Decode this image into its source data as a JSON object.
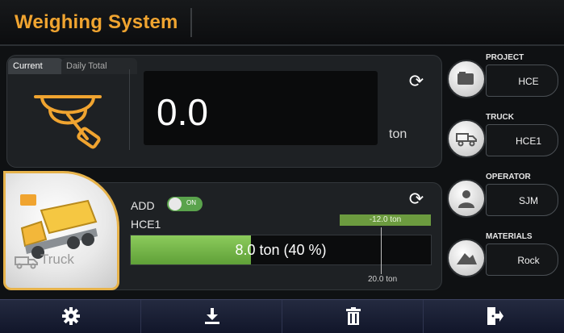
{
  "header": {
    "title": "Weighing System"
  },
  "tabs": {
    "current": "Current",
    "daily_total": "Daily Total"
  },
  "display": {
    "value": "0.0",
    "unit": "ton"
  },
  "truck_card": {
    "label": "Truck"
  },
  "add_toggle": {
    "label": "ADD",
    "state_text": "ON",
    "on": true
  },
  "load": {
    "truck_name": "HCE1",
    "progress_text": "8.0 ton (40 %)",
    "progress_fraction": 0.4,
    "remaining_badge": "-12.0 ton",
    "capacity_label": "20.0 ton"
  },
  "side_panel": [
    {
      "label": "PROJECT",
      "value": "HCE",
      "icon": "project-icon"
    },
    {
      "label": "TRUCK",
      "value": "HCE1",
      "icon": "truck-icon"
    },
    {
      "label": "OPERATOR",
      "value": "SJM",
      "icon": "operator-icon"
    },
    {
      "label": "MATERIALS",
      "value": "Rock",
      "icon": "materials-icon"
    }
  ],
  "toolbar": [
    "settings-icon",
    "download-icon",
    "delete-icon",
    "exit-icon"
  ],
  "colors": {
    "accent": "#f0a430",
    "progress": "#7dbb4f",
    "footer": "#1a2036"
  }
}
